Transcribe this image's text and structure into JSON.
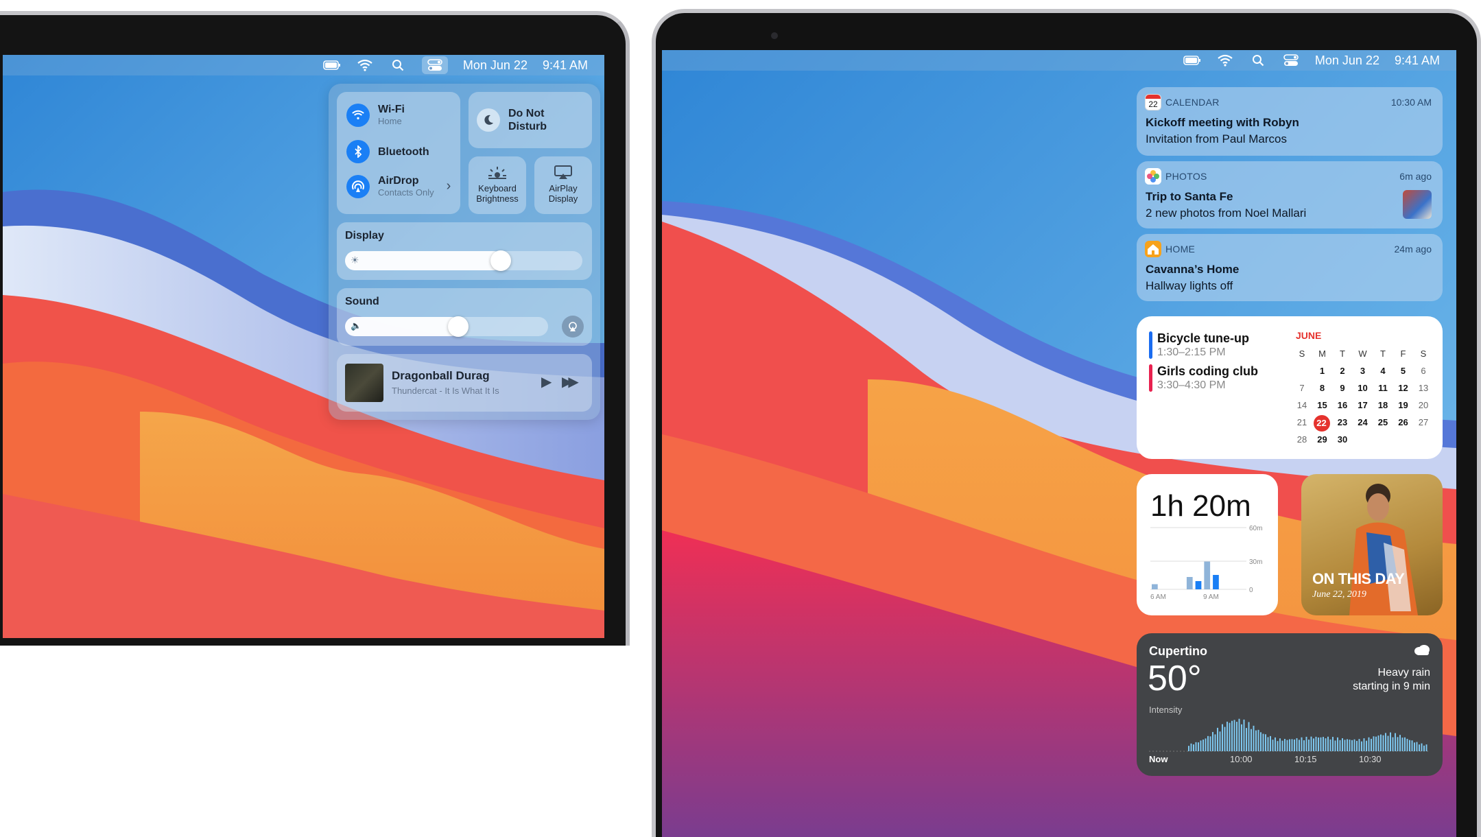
{
  "menubar": {
    "date": "Mon Jun 22",
    "time": "9:41 AM",
    "icons": [
      "battery-icon",
      "wifi-icon",
      "search-icon",
      "control-center-icon"
    ]
  },
  "control_center": {
    "wifi": {
      "label": "Wi-Fi",
      "sub": "Home"
    },
    "bluetooth": {
      "label": "Bluetooth"
    },
    "airdrop": {
      "label": "AirDrop",
      "sub": "Contacts Only"
    },
    "dnd": {
      "label_line1": "Do Not",
      "label_line2": "Disturb"
    },
    "keyboard": {
      "label_line1": "Keyboard",
      "label_line2": "Brightness"
    },
    "airplay": {
      "label_line1": "AirPlay",
      "label_line2": "Display"
    },
    "display": {
      "label": "Display",
      "level": 0.62
    },
    "sound": {
      "label": "Sound",
      "level": 0.55
    },
    "now_playing": {
      "title": "Dragonball Durag",
      "artist": "Thundercat - It Is What It Is"
    }
  },
  "notifications": [
    {
      "app": "CALENDAR",
      "time": "10:30 AM",
      "title": "Kickoff meeting with Robyn",
      "body": "Invitation from Paul Marcos",
      "icon": "calendar-icon",
      "icon_text": "22"
    },
    {
      "app": "PHOTOS",
      "time": "6m ago",
      "title": "Trip to Santa Fe",
      "body": "2 new photos from Noel Mallari",
      "icon": "photos-icon"
    },
    {
      "app": "HOME",
      "time": "24m ago",
      "title": "Cavanna’s Home",
      "body": "Hallway lights off",
      "icon": "home-icon"
    }
  ],
  "calendar_widget": {
    "events": [
      {
        "title": "Bicycle tune-up",
        "time": "1:30–2:15 PM",
        "color": "#1a6cf0"
      },
      {
        "title": "Girls coding club",
        "time": "3:30–4:30 PM",
        "color": "#e8214f"
      }
    ],
    "month": "JUNE",
    "weekdays": [
      "S",
      "M",
      "T",
      "W",
      "T",
      "F",
      "S"
    ],
    "weeks": [
      [
        "",
        "1",
        "2",
        "3",
        "4",
        "5",
        "6"
      ],
      [
        "7",
        "8",
        "9",
        "10",
        "11",
        "12",
        "13"
      ],
      [
        "14",
        "15",
        "16",
        "17",
        "18",
        "19",
        "20"
      ],
      [
        "21",
        "22",
        "23",
        "24",
        "25",
        "26",
        "27"
      ],
      [
        "28",
        "29",
        "30",
        "",
        "",
        "",
        ""
      ]
    ],
    "today": "22"
  },
  "screen_time": {
    "total": "1h 20m",
    "y_labels": [
      "60m",
      "30m",
      "0"
    ],
    "x_labels": [
      "6 AM",
      "9 AM"
    ],
    "bars": [
      5,
      0,
      0,
      0,
      12,
      8,
      27,
      14,
      0,
      0,
      0
    ]
  },
  "photo_memory": {
    "title": "ON THIS DAY",
    "date": "June 22, 2019"
  },
  "weather": {
    "city": "Cupertino",
    "temp": "50°",
    "condition_line1": "Heavy rain",
    "condition_line2": "starting in 9 min",
    "intensity_label": "Intensity",
    "x_labels": [
      "Now",
      "10:00",
      "10:15",
      "10:30"
    ],
    "icon": "cloud-icon"
  },
  "colors": {
    "accent": "#1a7ff5",
    "calendar_red": "#e5322d"
  }
}
